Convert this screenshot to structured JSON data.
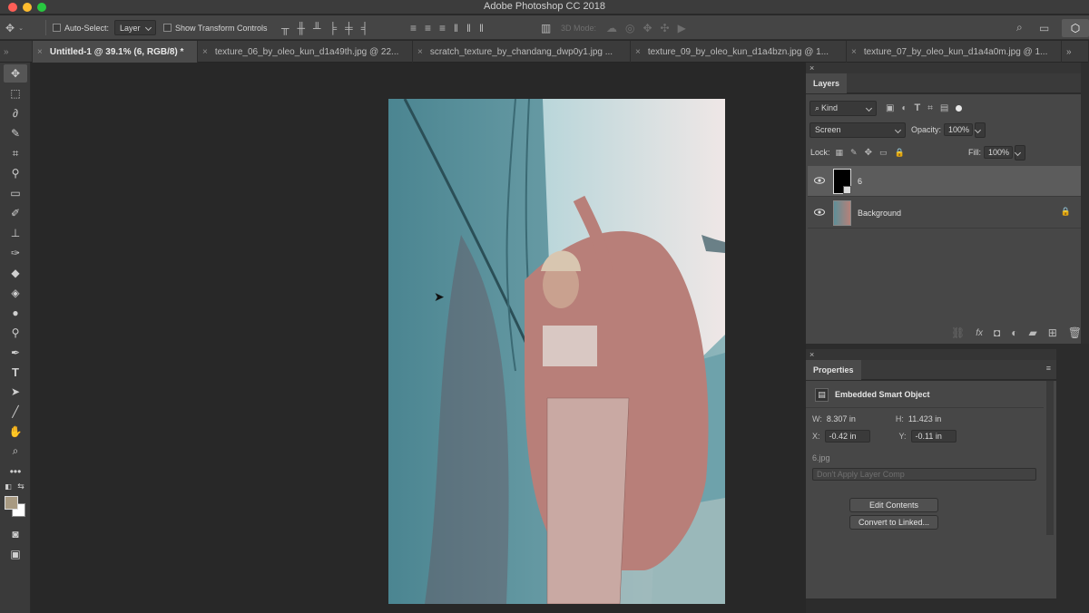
{
  "app": {
    "title": "Adobe Photoshop CC 2018",
    "window_controls": [
      "close-icon",
      "minimize-icon",
      "maximize-icon"
    ],
    "colors": {
      "close": "#fe5f57",
      "minimize": "#febc2e",
      "maximize": "#28c840"
    }
  },
  "options_bar": {
    "auto_select_label": "Auto-Select:",
    "auto_select_value": "Layer",
    "show_transform_label": "Show Transform Controls",
    "mode_3d_label": "3D Mode:",
    "icons": [
      "move-tool-icon",
      "align-top-icon",
      "align-vcenter-icon",
      "align-bottom-icon",
      "align-left-icon",
      "align-hcenter-icon",
      "align-right-icon",
      "distribute-top-icon",
      "distribute-vcenter-icon",
      "distribute-bottom-icon",
      "distribute-left-icon",
      "distribute-hcenter-icon",
      "distribute-right-icon",
      "auto-align-icon",
      "orbit-3d-icon",
      "roll-3d-icon",
      "drag-3d-icon",
      "slide-3d-icon",
      "scale-3d-icon",
      "search-icon",
      "workspace-icon",
      "share-icon"
    ]
  },
  "tabs": [
    {
      "label": "Untitled-1 @ 39.1% (6, RGB/8) *",
      "active": true
    },
    {
      "label": "texture_06_by_oleo_kun_d1a49th.jpg @ 22...",
      "active": false
    },
    {
      "label": "scratch_texture_by_chandang_dwp0y1.jpg ...",
      "active": false
    },
    {
      "label": "texture_09_by_oleo_kun_d1a4bzn.jpg @ 1...",
      "active": false
    },
    {
      "label": "texture_07_by_oleo_kun_d1a4a0m.jpg @ 1...",
      "active": false
    }
  ],
  "tools": [
    "move-tool-icon",
    "marquee-tool-icon",
    "lasso-tool-icon",
    "quick-select-tool-icon",
    "crop-tool-icon",
    "eyedropper-tool-icon",
    "healing-brush-tool-icon",
    "brush-tool-icon",
    "clone-stamp-tool-icon",
    "history-brush-tool-icon",
    "eraser-tool-icon",
    "paint-bucket-tool-icon",
    "blur-tool-icon",
    "dodge-tool-icon",
    "pen-tool-icon",
    "type-tool-icon",
    "path-select-tool-icon",
    "line-tool-icon",
    "hand-tool-icon",
    "zoom-tool-icon",
    "more-tools-icon",
    "default-colors-icon",
    "swap-colors-icon",
    "color-swatches",
    "quick-mask-icon",
    "screen-mode-icon"
  ],
  "colors": {
    "foreground": "#a89a82",
    "background": "#ffffff"
  },
  "layers_panel": {
    "title": "Layers",
    "filter_label": "Kind",
    "blend_mode": "Screen",
    "opacity_label": "Opacity:",
    "opacity_value": "100%",
    "lock_label": "Lock:",
    "fill_label": "Fill:",
    "fill_value": "100%",
    "layers": [
      {
        "name": "6",
        "selected": true
      },
      {
        "name": "Background",
        "selected": false
      }
    ],
    "footer_icons": [
      "link-icon",
      "fx-icon",
      "mask-icon",
      "adjustment-icon",
      "group-icon",
      "new-layer-icon",
      "trash-icon"
    ]
  },
  "properties_panel": {
    "title": "Properties",
    "object_type": "Embedded Smart Object",
    "w_label": "W:",
    "w_value": "8.307 in",
    "h_label": "H:",
    "h_value": "11.423 in",
    "x_label": "X:",
    "x_value": "-0.42 in",
    "y_label": "Y:",
    "y_value": "-0.11 in",
    "filename": "6.jpg",
    "layer_comp": "Don't Apply Layer Comp",
    "edit_contents": "Edit Contents",
    "convert_linked": "Convert to Linked..."
  }
}
